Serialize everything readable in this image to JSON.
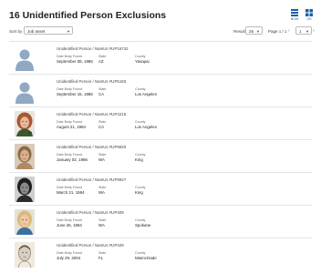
{
  "header": {
    "title": "16 Unidentified Person Exclusions",
    "view_list_label": "NOW",
    "view_grid_label": "GR"
  },
  "toolbar": {
    "sort_label": "Sort by",
    "sort_value": "Job asset",
    "results_label": "Results",
    "results_value": "25",
    "page_label": "Page 1 / 1",
    "page_value": "1",
    "prev": "‹",
    "next": "›"
  },
  "fields": {
    "date_label": "Date Body Found",
    "state_label": "State",
    "county_label": "County"
  },
  "cases": [
    {
      "title": "Unidentified Person / NamUs #UP16742",
      "date": "September 08, 1986",
      "state": "AZ",
      "county": "Yavapai",
      "photo": "silhouette"
    },
    {
      "title": "Unidentified Person / NamUs #UP6193",
      "date": "September 15, 1986",
      "state": "CA",
      "county": "Los Angeles",
      "photo": "silhouette"
    },
    {
      "title": "Unidentified Person / NamUs #UP4215",
      "date": "August 21, 1984",
      "state": "CA",
      "county": "Los Angeles",
      "photo": "redhair-portrait",
      "photo_caption": "left"
    },
    {
      "title": "Unidentified Person / NamUs #UP9920",
      "date": "January 02, 1986",
      "state": "WA",
      "county": "King",
      "photo": "sketch-portrait"
    },
    {
      "title": "Unidentified Person / NamUs #UP9927",
      "date": "March 21, 1984",
      "state": "WA",
      "county": "King",
      "photo": "bw-portrait"
    },
    {
      "title": "Unidentified Person / NamUs #UP409",
      "date": "June 26, 1984",
      "state": "WA",
      "county": "Spokane",
      "photo": "blonde-portrait"
    },
    {
      "title": "Unidentified Person / NamUs #UP429",
      "date": "July 29, 2004",
      "state": "FL",
      "county": "Miami-Dade",
      "photo": "pencil-sketch"
    }
  ],
  "colors": {
    "accent": "#1a5fa8",
    "silhouette": "#8fa8c4",
    "divider": "#e4e4e4"
  }
}
